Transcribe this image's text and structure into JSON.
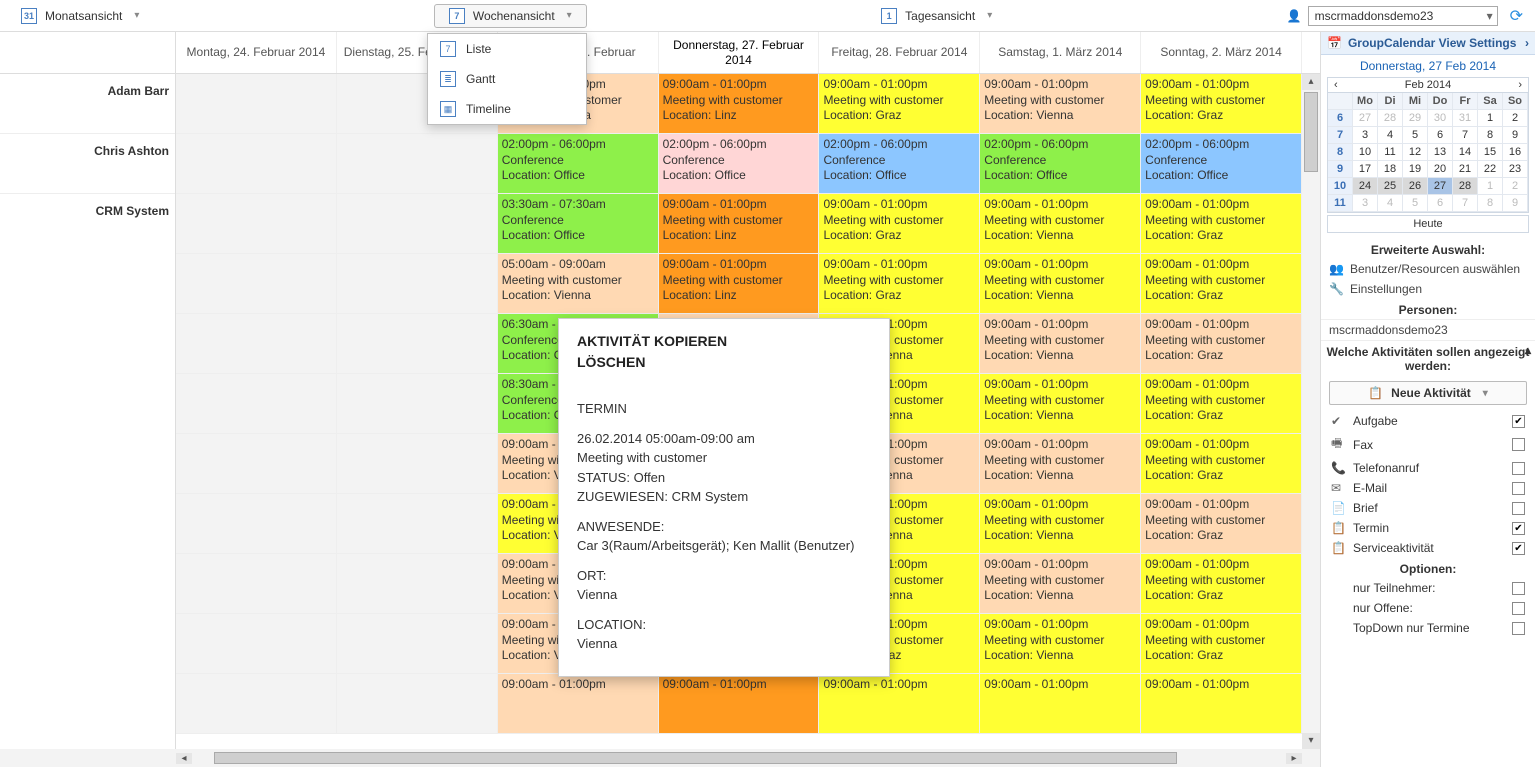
{
  "topbar": {
    "month": "Monatsansicht",
    "week": "Wochenansicht",
    "day": "Tagesansicht",
    "month_ic": "31",
    "week_ic": "7",
    "day_ic": "1",
    "user": "mscrmaddonsdemo23"
  },
  "dropdown": {
    "items": [
      {
        "icon": "7",
        "label": "Liste"
      },
      {
        "icon": "≣",
        "label": "Gantt"
      },
      {
        "icon": "▦",
        "label": "Timeline"
      }
    ]
  },
  "days": [
    "Montag, 24. Februar 2014",
    "Dienstag, 25. Februar 2014",
    "Mittwoch, 26. Februar",
    "Donnerstag, 27. Februar 2014",
    "Freitag, 28. Februar 2014",
    "Samstag, 1. März 2014",
    "Sonntag, 2. März 2014"
  ],
  "rows": [
    "Adam Barr",
    "Chris Ashton",
    "CRM System"
  ],
  "events": {
    "mc_orange": {
      "time": "09:00am - 01:00pm",
      "title": "Meeting with customer",
      "loc": "Location: Linz"
    },
    "mc_graz": {
      "time": "09:00am - 01:00pm",
      "title": "Meeting with customer",
      "loc": "Location: Graz"
    },
    "mc_vienna": {
      "time": "09:00am - 01:00pm",
      "title": "Meeting with customer",
      "loc": "Location: Vienna"
    },
    "conf": {
      "time": "02:00pm - 06:00pm",
      "title": "Conference",
      "loc": "Location: Office"
    },
    "crm_a": {
      "time": "03:30am - 07:30am",
      "title": "Conference",
      "loc": "Location: Office"
    },
    "crm_b": {
      "time": "05:00am - 09:00am",
      "title": "Meeting with customer",
      "loc": "Location: Vienna"
    },
    "crm_c": {
      "time": "06:30am - 10:30am",
      "title": "Conference",
      "loc": "Location: Office"
    },
    "crm_d": {
      "time": "08:30am - 12:30pm",
      "title": "Conference",
      "loc": "Location: Office"
    }
  },
  "tooltip": {
    "h1": "AKTIVITÄT KOPIEREN",
    "h2": "LÖSCHEN",
    "type": "TERMIN",
    "dt": "26.02.2014 05:00am-09:00 am",
    "subject": "Meeting with customer",
    "status": "STATUS: Offen",
    "assigned": "ZUGEWIESEN: CRM System",
    "attendees_lbl": "ANWESENDE:",
    "attendees": "Car 3(Raum/Arbeitsgerät); Ken Mallit (Benutzer)",
    "ort_lbl": "ORT:",
    "ort": "Vienna",
    "loc_lbl": "LOCATION:",
    "loc": "Vienna"
  },
  "right": {
    "header": "GroupCalendar View Settings",
    "date": "Donnerstag, 27 Feb 2014",
    "month": "Feb 2014",
    "dow": [
      "Mo",
      "Di",
      "Mi",
      "Do",
      "Fr",
      "Sa",
      "So"
    ],
    "weeks": [
      "6",
      "7",
      "8",
      "9",
      "10",
      "11"
    ],
    "grid": [
      [
        "27",
        "28",
        "29",
        "30",
        "31",
        "1",
        "2"
      ],
      [
        "3",
        "4",
        "5",
        "6",
        "7",
        "8",
        "9"
      ],
      [
        "10",
        "11",
        "12",
        "13",
        "14",
        "15",
        "16"
      ],
      [
        "17",
        "18",
        "19",
        "20",
        "21",
        "22",
        "23"
      ],
      [
        "24",
        "25",
        "26",
        "27",
        "28",
        "1",
        "2"
      ],
      [
        "3",
        "4",
        "5",
        "6",
        "7",
        "8",
        "9"
      ]
    ],
    "today_btn": "Heute",
    "erw": "Erweiterte Auswahl:",
    "link1": "Benutzer/Resourcen auswählen",
    "link2": "Einstellungen",
    "personen_h": "Personen:",
    "person": "mscrmaddonsdemo23",
    "filter_h": "Welche Aktivitäten sollen angezeigt werden:",
    "new_act": "Neue Aktivität",
    "types": [
      {
        "label": "Aufgabe",
        "on": true
      },
      {
        "label": "Fax",
        "on": false
      },
      {
        "label": "Telefonanruf",
        "on": false
      },
      {
        "label": "E-Mail",
        "on": false
      },
      {
        "label": "Brief",
        "on": false
      },
      {
        "label": "Termin",
        "on": true
      },
      {
        "label": "Serviceaktivität",
        "on": true
      }
    ],
    "opt_h": "Optionen:",
    "opts": [
      {
        "label": "nur Teilnehmer:",
        "on": false
      },
      {
        "label": "nur Offene:",
        "on": false
      },
      {
        "label": "TopDown nur Termine",
        "on": false
      }
    ]
  }
}
